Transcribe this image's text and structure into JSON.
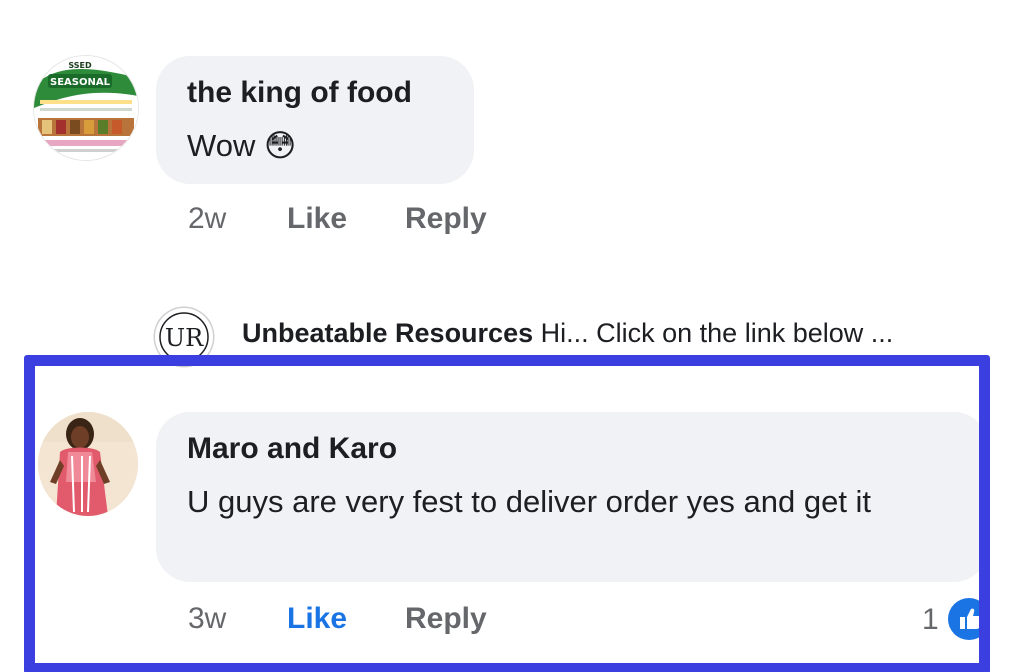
{
  "comments": [
    {
      "author": "the king of food",
      "text": "Wow 😳",
      "time": "2w",
      "like_label": "Like",
      "reply_label": "Reply",
      "avatar_icon": "seasonal-food-flyer-avatar",
      "avatar_texts": [
        "SSED",
        "SEASONAL"
      ]
    },
    {
      "author": "Maro and Karo",
      "text": "U guys are very fest to deliver order yes and get it",
      "time": "3w",
      "like_label": "Like",
      "like_active": true,
      "reply_label": "Reply",
      "reaction_count": "1",
      "reaction_icon": "like-thumb-icon",
      "avatar_icon": "person-photo-avatar"
    }
  ],
  "reply_preview": {
    "logo_text": "UR",
    "author": "Unbeatable Resources",
    "snippet": "Hi... Click on the link below ..."
  },
  "colors": {
    "bubble": "#f0f2f5",
    "link_blue": "#1b74e4",
    "highlight": "#3b3fe0",
    "meta_gray": "#65676b"
  }
}
